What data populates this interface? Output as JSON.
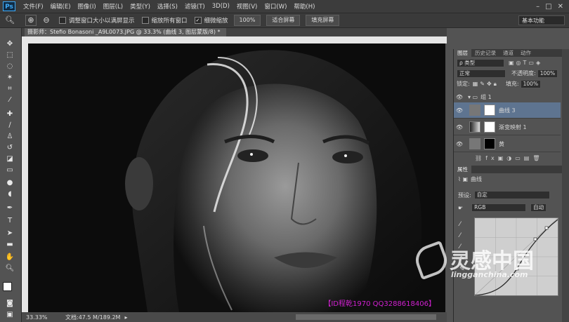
{
  "app": {
    "logo": "Ps",
    "window_controls": [
      "–",
      "□",
      "✕"
    ]
  },
  "menu": [
    "文件(F)",
    "编辑(E)",
    "图像(I)",
    "图层(L)",
    "类型(Y)",
    "选择(S)",
    "滤镜(T)",
    "3D(D)",
    "视图(V)",
    "窗口(W)",
    "帮助(H)"
  ],
  "options": {
    "resize_windows": "调整窗口大小以满屏显示",
    "zoom_all": "缩放所有窗口",
    "scrubby_zoom": "细微缩放",
    "zoom_100": "100%",
    "fit_screen": "适合屏幕",
    "fill_screen": "填充屏幕",
    "workspace": "基本功能"
  },
  "document": {
    "tab_title": "摄影师：Stefio Bonasoni _A9L0073.JPG @ 33.3% (曲线 3, 图层蒙版/8) *"
  },
  "status": {
    "zoom": "33.33%",
    "doc": "文档:47.5 M/189.2M"
  },
  "canvas": {
    "watermark": "【ID程乾1970  QQ3288618406】"
  },
  "panels": {
    "layers_tabs": [
      "图层",
      "历史记录",
      "通道",
      "动作"
    ],
    "filter_kind": "ρ 类型",
    "blend_mode": "正常",
    "opacity_label": "不透明度:",
    "opacity_value": "100%",
    "lock_label": "锁定:",
    "fill_label": "填充:",
    "fill_value": "100%",
    "group_name": "组 1",
    "layers": [
      "曲线 3",
      "渐变映射 1",
      "黄"
    ],
    "properties_tab": "属性",
    "properties_title": "曲线",
    "preset_label": "预设:",
    "preset_value": "自定",
    "channel_value": "RGB",
    "auto_button": "自动"
  },
  "brand": {
    "name": "灵感中国",
    "url": "lingganchina.com"
  },
  "colors": {
    "magenta": "#d020d0",
    "panel": "#535353",
    "selected_layer": "#5e7490"
  }
}
